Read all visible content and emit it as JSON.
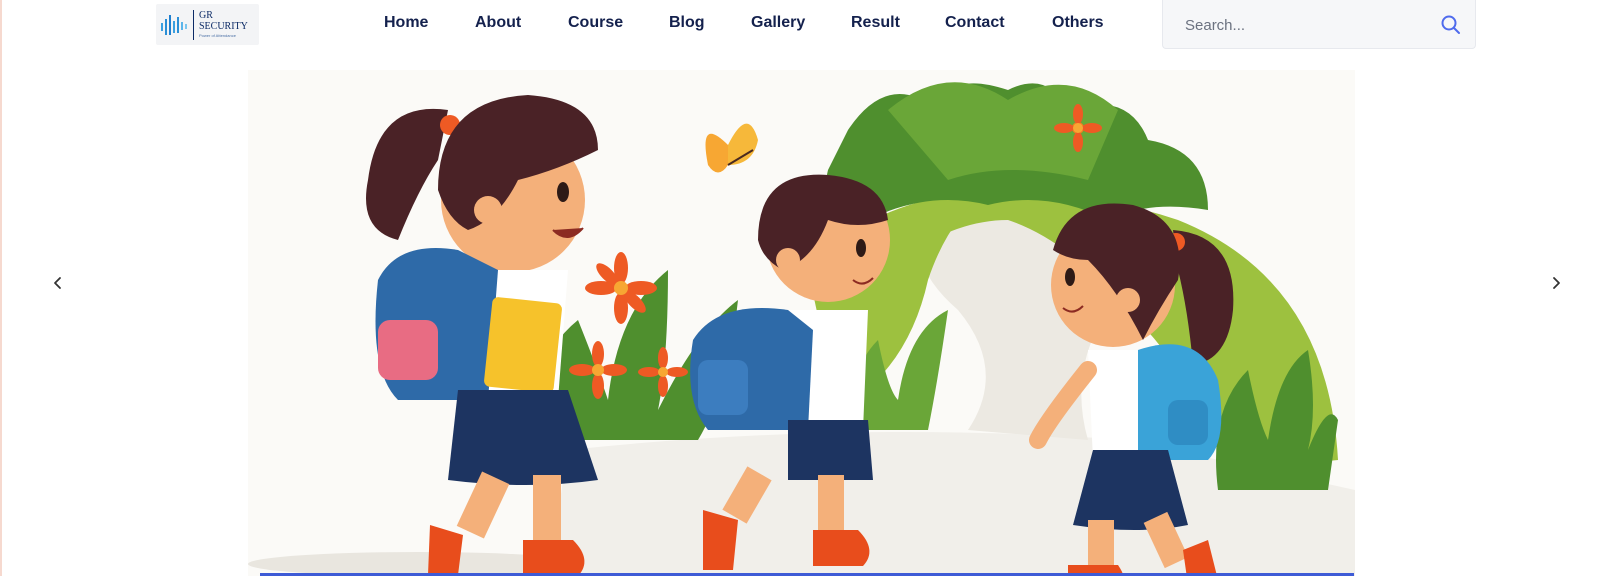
{
  "brand": {
    "line1": "GR",
    "line2": "SECURITY",
    "tagline": "Power of Attendance"
  },
  "nav": {
    "items": [
      {
        "label": "Home"
      },
      {
        "label": "About"
      },
      {
        "label": "Course"
      },
      {
        "label": "Blog"
      },
      {
        "label": "Gallery"
      },
      {
        "label": "Result"
      },
      {
        "label": "Contact"
      },
      {
        "label": "Others"
      }
    ]
  },
  "search": {
    "placeholder": "Search...",
    "value": "",
    "icon": "search-icon"
  },
  "hero": {
    "image": "children-walking-to-school-illustration",
    "prev_icon": "chevron-left-icon",
    "next_icon": "chevron-right-icon"
  },
  "colors": {
    "nav_text": "#14214d",
    "search_icon": "#4f6bed",
    "accent_bar": "#3e5bd6",
    "brand_blue": "#0b2a66"
  }
}
